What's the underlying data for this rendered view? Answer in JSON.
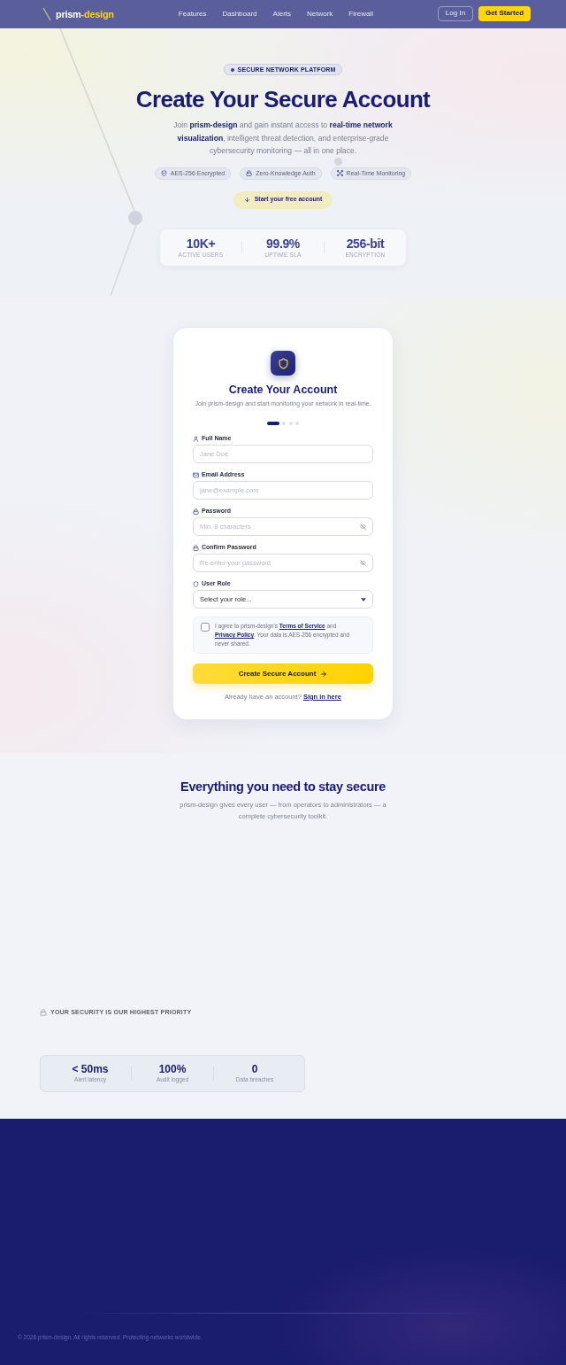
{
  "nav": {
    "logo": {
      "prefix": "prism",
      "suffix": "-design"
    },
    "links": [
      {
        "label": "Features"
      },
      {
        "label": "Dashboard"
      },
      {
        "label": "Alerts"
      },
      {
        "label": "Network"
      },
      {
        "label": "Firewall"
      }
    ],
    "login": "Log In",
    "cta": "Get Started"
  },
  "hero": {
    "badge": "SECURE NETWORK PLATFORM",
    "title": "Create Your Secure Account",
    "subtitle": "Join **prism-design** and gain instant access to **real-time network visualization**, intelligent threat detection, and enterprise-grade cybersecurity monitoring — all in one place.",
    "chips": [
      {
        "label": "AES-256 Encrypted"
      },
      {
        "label": "Zero-Knowledge Auth"
      },
      {
        "label": "Real-Time Monitoring"
      }
    ],
    "cta": "Start your free account",
    "stats": [
      {
        "value": "10K+",
        "label": "ACTIVE USERS"
      },
      {
        "value": "99.9%",
        "label": "UPTIME SLA"
      },
      {
        "value": "256-bit",
        "label": "ENCRYPTION"
      }
    ]
  },
  "signup_form": {
    "title": "Create Your Account",
    "subtitle": "Join prism-design and start monitoring your network in real-time.",
    "steps": [
      {
        "selected": true
      },
      {
        "selected": false
      },
      {
        "selected": false
      },
      {
        "selected": false
      }
    ],
    "fields": [
      {
        "kind": "text",
        "label": "Full Name",
        "placeholder": "Jane Doe"
      },
      {
        "kind": "email",
        "label": "Email Address",
        "placeholder": "jane@example.com"
      },
      {
        "kind": "password",
        "label": "Password",
        "placeholder": "Min. 8 characters"
      },
      {
        "kind": "password",
        "label": "Confirm Password",
        "placeholder": "Re-enter your password"
      },
      {
        "kind": "select",
        "label": "User Role",
        "value": "Select your role..."
      }
    ],
    "consent": {
      "checked": false,
      "parts": [
        {
          "kind": "text",
          "text": "I agree to prism-design's "
        },
        {
          "kind": "link",
          "text": "Terms of Service"
        },
        {
          "kind": "text",
          "text": " and "
        },
        {
          "kind": "link",
          "text": "Privacy Policy"
        },
        {
          "kind": "text",
          "text": ". Your data is AES-256 encrypted and never shared."
        }
      ]
    },
    "submit": "Create Secure Account",
    "sign_in": {
      "text": "Already have an account?",
      "link": "Sign in here"
    }
  },
  "features": {
    "title": "Everything you need to stay secure",
    "subtitle": "prism-design gives every user — from operators to administrators — a complete cybersecurity toolkit."
  },
  "security": {
    "eyebrow": "YOUR SECURITY IS OUR HIGHEST PRIORITY",
    "stats": [
      {
        "value": "< 50ms",
        "label": "Alert latency"
      },
      {
        "value": "100%",
        "label": "Audit logged"
      },
      {
        "value": "0",
        "label": "Data breaches"
      }
    ]
  },
  "footer": {
    "copyright": "© 2026 prism-design. All rights reserved. Protecting networks worldwide."
  }
}
